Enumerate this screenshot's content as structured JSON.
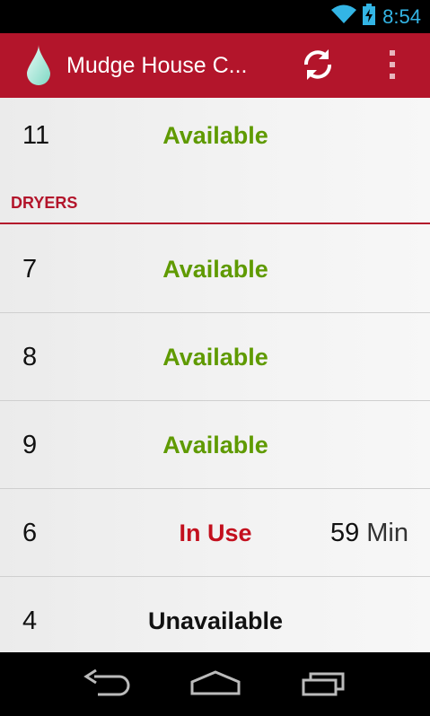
{
  "status_bar": {
    "time": "8:54",
    "wifi_icon": "wifi-icon",
    "battery_icon": "battery-charging-icon"
  },
  "action_bar": {
    "app_icon": "water-drop-icon",
    "title": "Mudge House C...",
    "refresh_icon": "refresh-icon",
    "overflow_icon": "overflow-menu-icon",
    "color": "#b3152b"
  },
  "washers_partial": {
    "number": "11",
    "status": "Available"
  },
  "dryers": {
    "header": "DRYERS",
    "rows": [
      {
        "number": "7",
        "status": "Available",
        "time": "",
        "unit": ""
      },
      {
        "number": "8",
        "status": "Available",
        "time": "",
        "unit": ""
      },
      {
        "number": "9",
        "status": "Available",
        "time": "",
        "unit": ""
      },
      {
        "number": "6",
        "status": "In Use",
        "time": "59",
        "unit": "Min"
      },
      {
        "number": "4",
        "status": "Unavailable",
        "time": "",
        "unit": ""
      }
    ]
  },
  "colors": {
    "available": "#5f9a00",
    "in_use": "#c3101e",
    "unavailable": "#111111"
  },
  "nav_bar": {
    "back_icon": "back-icon",
    "home_icon": "home-icon",
    "recents_icon": "recents-icon"
  }
}
